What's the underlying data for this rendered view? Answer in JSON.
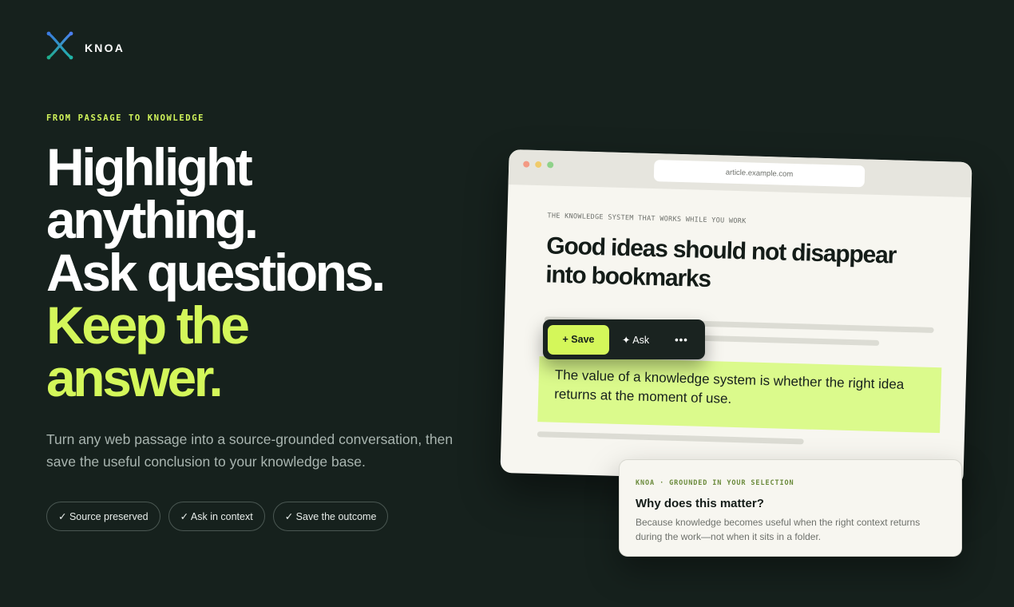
{
  "brand": {
    "name": "KNOA",
    "logo_icon": "knoa-x-logo-icon"
  },
  "hero": {
    "eyebrow": "FROM PASSAGE TO KNOWLEDGE",
    "headline_lines": [
      "Highlight",
      "anything.",
      "Ask questions."
    ],
    "accent_lines": [
      "Keep the",
      "answer."
    ],
    "subtitle": "Turn any web passage into a source-grounded conversation, then save the useful conclusion to your knowledge base.",
    "chips": [
      "✓ Source preserved",
      "✓ Ask in context",
      "✓ Save the outcome"
    ]
  },
  "browser": {
    "url": "article.example.com",
    "kicker": "THE KNOWLEDGE SYSTEM THAT WORKS WHILE YOU WORK",
    "title": "Good ideas should not disappear into bookmarks",
    "highlighted_text": "The value of a knowledge system is whether the right idea returns at the moment of use."
  },
  "toolbar": {
    "save_label": "+ Save",
    "ask_label": "✦ Ask",
    "more_label": "•••"
  },
  "answer_card": {
    "kicker": "KNOA · GROUNDED IN YOUR SELECTION",
    "question": "Why does this matter?",
    "answer": "Because knowledge becomes useful when the right context returns during the work—not when it sits in a folder."
  },
  "colors": {
    "background": "#16211d",
    "accent": "#d4f75a",
    "highlight": "#dbfa8c",
    "paper": "#f7f6f0"
  }
}
